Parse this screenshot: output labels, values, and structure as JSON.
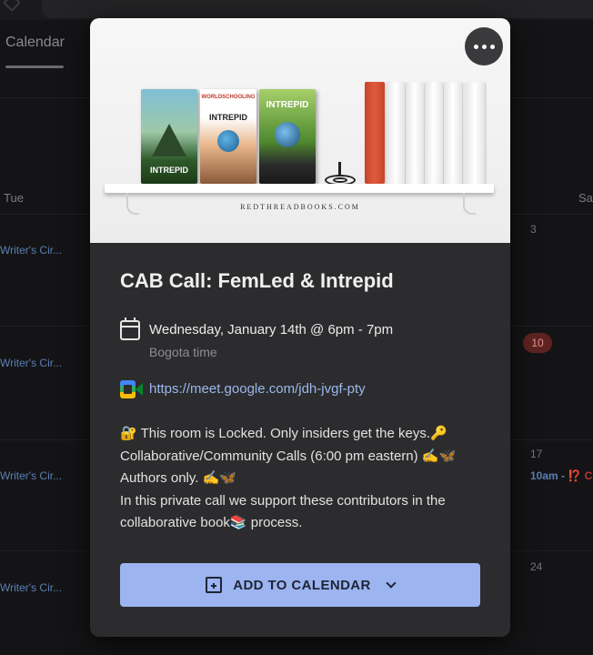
{
  "background": {
    "tab_label": "Calendar",
    "day_tue": "Tue",
    "day_sat": "Sat",
    "event_label": "Writer's Cir...",
    "dates": [
      "3",
      "10",
      "17",
      "24"
    ],
    "right_event": {
      "time": "10am - ",
      "badge": "⁉️ C"
    }
  },
  "event": {
    "title": "CAB Call: FemLed & Intrepid",
    "datetime": "Wednesday, January 14th @ 6pm - 7pm",
    "timezone": "Bogota time",
    "meet_link": "https://meet.google.com/jdh-jvgf-pty",
    "description_lines": [
      "🔐 This room is Locked. Only insiders get the keys.🔑",
      "Collaborative/Community Calls (6:00 pm eastern) ✍️🦋",
      "Authors only. ✍️🦋",
      "In this private call we support these contributors in the",
      "collaborative book📚 process."
    ],
    "add_button_label": "ADD TO CALENDAR"
  },
  "hero_image": {
    "brand_text": "REDTHREADBOOKS.COM",
    "book_titles": [
      "INTREPID",
      "INTREPID",
      "INTREPID"
    ],
    "book2_top": "WORLDSCHOOLING"
  },
  "icons": {
    "more": "more-vert-icon",
    "calendar": "calendar-icon",
    "meet": "google-meet-icon",
    "add": "calendar-add-icon",
    "chevron": "chevron-down-icon"
  },
  "colors": {
    "button_bg": "#9cb4f0",
    "link": "#9bb8ec",
    "card_bg": "#2c2c2e",
    "today_badge": "#5e2320"
  }
}
